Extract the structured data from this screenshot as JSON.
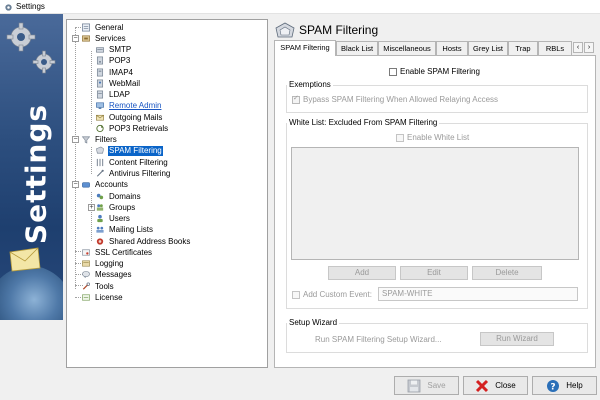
{
  "window": {
    "title": "Settings"
  },
  "banner": {
    "text": "Settings"
  },
  "tree": {
    "items": [
      {
        "label": "General",
        "icon": "general-icon",
        "style": "normal"
      },
      {
        "label": "Services",
        "icon": "services-icon",
        "style": "normal"
      },
      {
        "label": "SMTP",
        "icon": "smtp-icon",
        "style": "normal"
      },
      {
        "label": "POP3",
        "icon": "pop3-icon",
        "style": "normal"
      },
      {
        "label": "IMAP4",
        "icon": "imap4-icon",
        "style": "normal"
      },
      {
        "label": "WebMail",
        "icon": "webmail-icon",
        "style": "normal"
      },
      {
        "label": "LDAP",
        "icon": "ldap-icon",
        "style": "normal"
      },
      {
        "label": "Remote Admin",
        "icon": "remote-admin-icon",
        "style": "link"
      },
      {
        "label": "Outgoing Mails",
        "icon": "outgoing-mails-icon",
        "style": "normal"
      },
      {
        "label": "POP3 Retrievals",
        "icon": "pop3-retrievals-icon",
        "style": "normal"
      },
      {
        "label": "Filters",
        "icon": "filters-icon",
        "style": "normal"
      },
      {
        "label": "SPAM Filtering",
        "icon": "spam-filtering-icon",
        "style": "selected"
      },
      {
        "label": "Content Filtering",
        "icon": "content-filtering-icon",
        "style": "normal"
      },
      {
        "label": "Antivirus Filtering",
        "icon": "antivirus-filtering-icon",
        "style": "normal"
      },
      {
        "label": "Accounts",
        "icon": "accounts-icon",
        "style": "normal"
      },
      {
        "label": "Domains",
        "icon": "domains-icon",
        "style": "normal"
      },
      {
        "label": "Groups",
        "icon": "groups-icon",
        "style": "normal"
      },
      {
        "label": "Users",
        "icon": "users-icon",
        "style": "normal"
      },
      {
        "label": "Mailing Lists",
        "icon": "mailing-lists-icon",
        "style": "normal"
      },
      {
        "label": "Shared Address Books",
        "icon": "shared-address-books-icon",
        "style": "normal"
      },
      {
        "label": "SSL Certificates",
        "icon": "ssl-certificates-icon",
        "style": "normal"
      },
      {
        "label": "Logging",
        "icon": "logging-icon",
        "style": "normal"
      },
      {
        "label": "Messages",
        "icon": "messages-icon",
        "style": "normal"
      },
      {
        "label": "Tools",
        "icon": "tools-icon",
        "style": "normal"
      },
      {
        "label": "License",
        "icon": "license-icon",
        "style": "normal"
      }
    ]
  },
  "header": {
    "title": "SPAM Filtering",
    "icon": "spam-filtering-icon"
  },
  "tabs": [
    {
      "label": "SPAM Filtering",
      "active": true
    },
    {
      "label": "Black List",
      "active": false
    },
    {
      "label": "Miscellaneous",
      "active": false
    },
    {
      "label": "Hosts",
      "active": false
    },
    {
      "label": "Grey List",
      "active": false
    },
    {
      "label": "Trap",
      "active": false
    },
    {
      "label": "RBLs",
      "active": false
    }
  ],
  "panel": {
    "enable_spam_filtering": {
      "label": "Enable SPAM Filtering",
      "checked": false
    },
    "exemptions": {
      "title": "Exemptions",
      "bypass_label": "Bypass SPAM Filtering When Allowed Relaying Access",
      "bypass_checked": true
    },
    "whitelist": {
      "title": "White List: Excluded From SPAM Filtering",
      "enable_label": "Enable White List",
      "enable_checked": false,
      "add_label": "Add",
      "edit_label": "Edit",
      "delete_label": "Delete",
      "custom_event_label": "Add Custom Event:",
      "custom_event_value": "SPAM-WHITE"
    },
    "setup_wizard": {
      "title": "Setup Wizard",
      "run_text": "Run SPAM Filtering Setup Wizard...",
      "run_button": "Run Wizard"
    }
  },
  "buttons": {
    "save": "Save",
    "close": "Close",
    "help": "Help"
  },
  "colors": {
    "selection": "#0a64c8",
    "link": "#1a56c2",
    "close_x": "#d42020",
    "help_blue": "#2a6fb8"
  }
}
